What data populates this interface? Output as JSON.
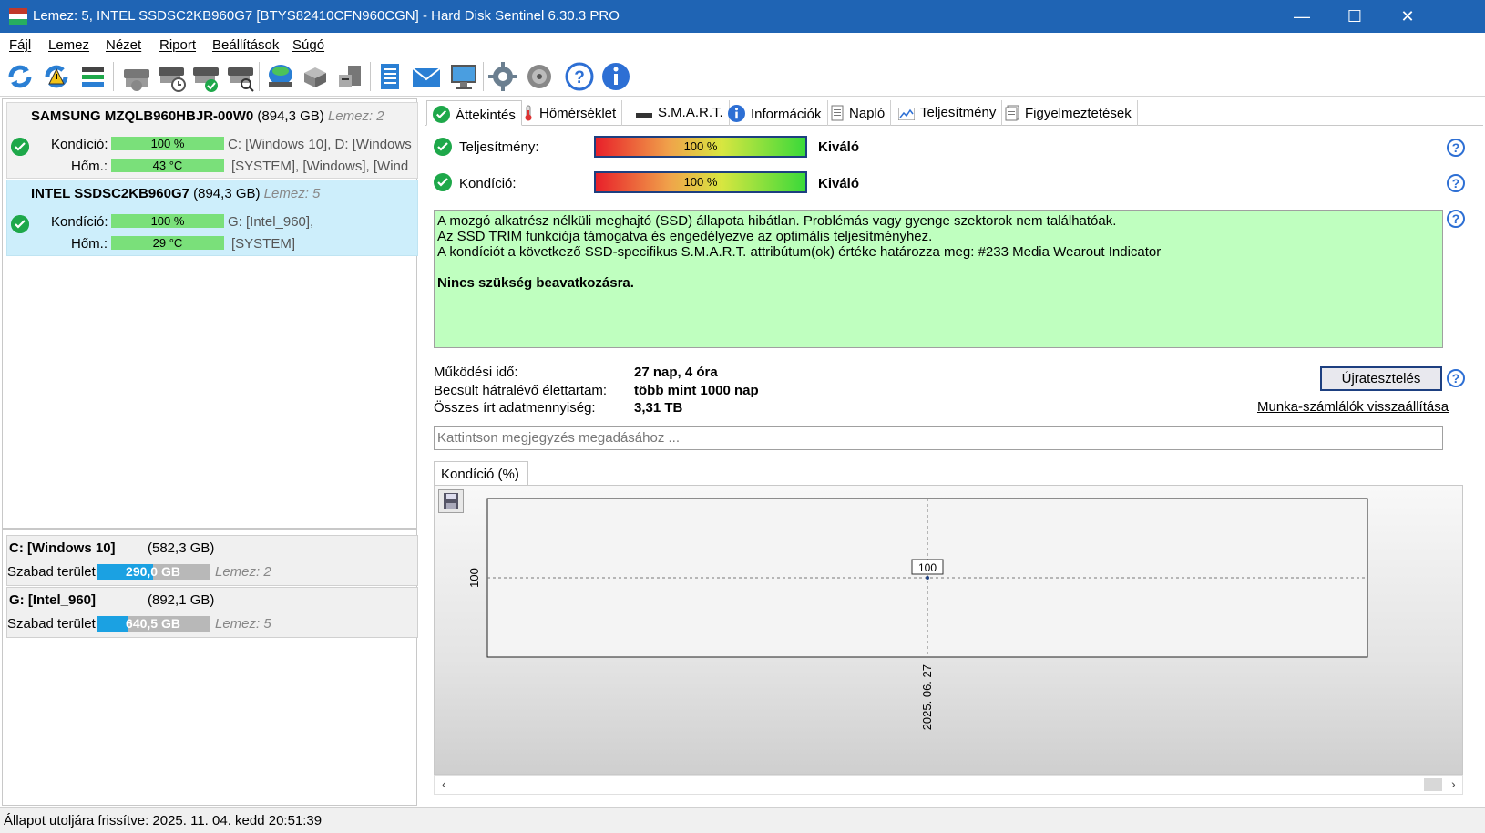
{
  "window": {
    "title": "Lemez: 5, INTEL SSDSC2KB960G7 [BTYS82410CFN960CGN]  -  Hard Disk Sentinel 6.30.3 PRO",
    "minimize": "—",
    "maximize": "☐",
    "close": "✕"
  },
  "menu": [
    "Fájl",
    "Lemez",
    "Nézet",
    "Riport",
    "Beállítások",
    "Súgó"
  ],
  "toolbar": {
    "icons": [
      "refresh-icon",
      "refresh-warning-icon",
      "disk-list-icon",
      "disk-icon",
      "disk-schedule-icon",
      "disk-check-icon",
      "disk-search-icon",
      "surface-test-icon",
      "network-disk-icon",
      "server-disk-icon",
      "report-icon",
      "email-icon",
      "network-monitor-icon",
      "settings-icon",
      "sound-icon",
      "help-icon",
      "info-icon"
    ]
  },
  "disks": [
    {
      "name": "SAMSUNG MZQLB960HBJR-00W0",
      "size": "(894,3 GB)",
      "lemez": "Lemez: 2",
      "kondicio_label": "Kondíció:",
      "kondicio": "100 %",
      "hom_label": "Hőm.:",
      "hom": "43 °C",
      "partitions1": "C: [Windows 10], D: [Windows",
      "partitions2": "[SYSTEM],  [Windows],  [Wind"
    },
    {
      "name": "INTEL SSDSC2KB960G7",
      "size": "(894,3 GB)",
      "lemez": "Lemez: 5",
      "kondicio_label": "Kondíció:",
      "kondicio": "100 %",
      "hom_label": "Hőm.:",
      "hom": "29 °C",
      "partitions1": "G: [Intel_960],",
      "partitions2": "[SYSTEM]"
    }
  ],
  "drives": [
    {
      "name": "C: [Windows 10]",
      "size": "(582,3 GB)",
      "free_label": "Szabad terület",
      "free": "290,0 GB",
      "free_fraction": 0.5,
      "lemez": "Lemez: 2"
    },
    {
      "name": "G: [Intel_960]",
      "size": "(892,1 GB)",
      "free_label": "Szabad terület",
      "free": "640,5 GB",
      "free_fraction": 0.28,
      "lemez": "Lemez: 5"
    }
  ],
  "tabs": [
    "Áttekintés",
    "Hőmérséklet",
    "S.M.A.R.T.",
    "Információk",
    "Napló",
    "Teljesítmény",
    "Figyelmeztetések"
  ],
  "overview": {
    "perf_label": "Teljesítmény:",
    "perf_value": "100 %",
    "perf_rating": "Kiváló",
    "cond_label": "Kondíció:",
    "cond_value": "100 %",
    "cond_rating": "Kiváló",
    "desc": [
      "A mozgó alkatrész nélküli meghajtó (SSD) állapota hibátlan. Problémás vagy gyenge szektorok nem találhatóak.",
      "Az SSD TRIM funkciója támogatva és engedélyezve az optimális teljesítményhez.",
      "A kondíciót a következő SSD-specifikus S.M.A.R.T. attribútum(ok) értéke határozza meg:  #233 Media Wearout Indicator"
    ],
    "desc_bold": "Nincs szükség beavatkozásra.",
    "uptime_label": "Működési idő:",
    "uptime": "27 nap, 4 óra",
    "life_label": "Becsült hátralévő élettartam:",
    "life": "több mint 1000 nap",
    "written_label": "Összes írt adatmennyiség:",
    "written": "3,31 TB",
    "retest_button": "Újratesztelés",
    "reset_link": "Munka-számlálók visszaállítása",
    "note_placeholder": "Kattintson megjegyzés megadásához ..."
  },
  "chart_tab": "Kondíció  (%)",
  "chart_data": {
    "type": "line",
    "x": [
      "2025. 06. 27"
    ],
    "series": [
      {
        "values": [
          100
        ]
      }
    ],
    "ylabel_tick": "100",
    "point_label": "100"
  },
  "status": "Állapot utoljára frissítve: 2025. 11. 04. kedd 20:51:39"
}
